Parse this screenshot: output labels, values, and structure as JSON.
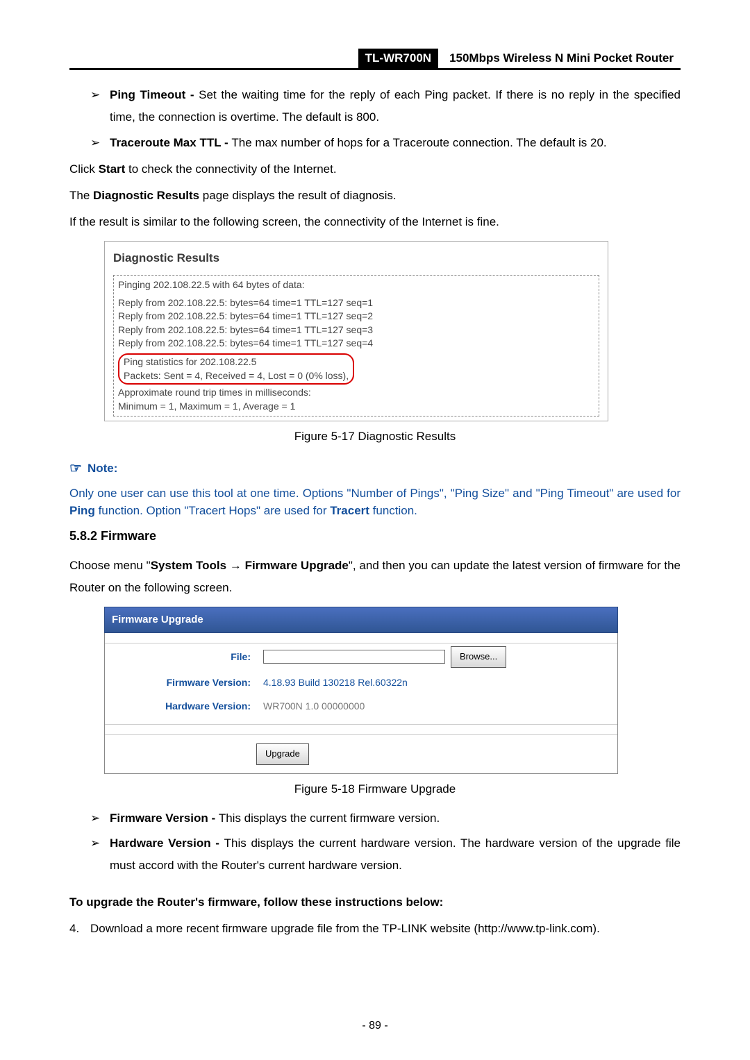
{
  "header": {
    "model": "TL-WR700N",
    "title": "150Mbps Wireless N Mini Pocket Router"
  },
  "bullets": {
    "ping_timeout_label": "Ping Timeout - ",
    "ping_timeout_text": "Set the waiting time for the reply of each Ping packet. If there is no reply in the specified time, the connection is overtime. The default is 800.",
    "traceroute_label": "Traceroute Max TTL - ",
    "traceroute_text": "The max number of hops for a Traceroute connection. The default is 20."
  },
  "paras": {
    "click_start_1": "Click ",
    "click_start_bold": "Start",
    "click_start_2": " to check the connectivity of the Internet.",
    "diag_page_1": "The ",
    "diag_page_bold": "Diagnostic Results",
    "diag_page_2": " page displays the result of diagnosis.",
    "if_result": "If the result is similar to the following screen, the connectivity of the Internet is fine."
  },
  "diag": {
    "title": "Diagnostic Results",
    "pinging": "Pinging 202.108.22.5 with 64 bytes of data:",
    "r1": "Reply from 202.108.22.5:  bytes=64  time=1  TTL=127  seq=1",
    "r2": "Reply from 202.108.22.5:  bytes=64  time=1  TTL=127  seq=2",
    "r3": "Reply from 202.108.22.5:  bytes=64  time=1  TTL=127  seq=3",
    "r4": "Reply from 202.108.22.5:  bytes=64  time=1  TTL=127  seq=4",
    "stats1": "Ping statistics for 202.108.22.5",
    "stats2": "Packets: Sent = 4, Received = 4, Lost = 0 (0% loss),",
    "approx": "Approximate round trip times in milliseconds:",
    "minmax": "Minimum = 1, Maximum = 1, Average = 1"
  },
  "fig517": "Figure 5-17   Diagnostic Results",
  "note": {
    "label": "Note:",
    "text_1": "Only one user can use this tool at one time. Options \"Number of Pings\", \"Ping Size\" and \"Ping Timeout\" are used for ",
    "ping_bold": "Ping",
    "text_2": " function. Option \"Tracert Hops\" are used for ",
    "tracert_bold": "Tracert",
    "text_3": " function."
  },
  "section": "5.8.2  Firmware",
  "choose": {
    "p1": "Choose menu \"",
    "b1": "System Tools",
    "arrow": " → ",
    "b2": "Firmware Upgrade",
    "p2": "\", and then you can update the latest version of firmware for the Router on the following screen."
  },
  "fw": {
    "header": "Firmware Upgrade",
    "file_label": "File:",
    "browse": "Browse...",
    "fwver_label": "Firmware Version:",
    "fwver_value": "4.18.93 Build 130218 Rel.60322n",
    "hwver_label": "Hardware Version:",
    "hwver_value": "WR700N 1.0 00000000",
    "upgrade": "Upgrade"
  },
  "fig518": "Figure 5-18   Firmware Upgrade",
  "bullets2": {
    "fwver_label": "Firmware Version - ",
    "fwver_text": "This displays the current firmware version.",
    "hwver_label": "Hardware Version - ",
    "hwver_text": "This displays the current hardware version. The hardware version of the upgrade file must accord with the Router's current hardware version."
  },
  "upgrade_instr": "To upgrade the Router's firmware, follow these instructions below:",
  "step4": {
    "num": "4.",
    "text": "Download a more recent firmware upgrade file from the TP-LINK website (http://www.tp-link.com)."
  },
  "page_num": "- 89 -"
}
